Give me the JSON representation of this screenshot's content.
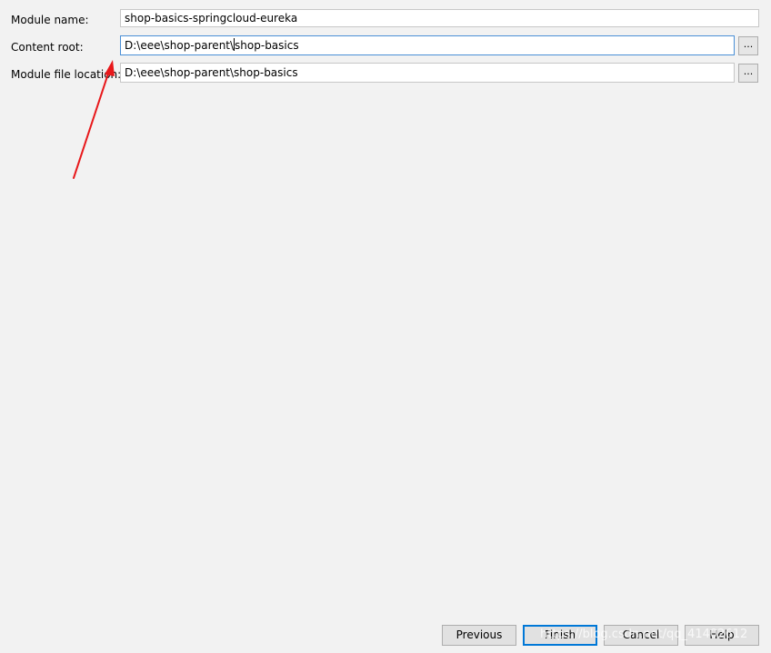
{
  "form": {
    "module_name": {
      "label": "Module name:",
      "value": "shop-basics-springcloud-eureka"
    },
    "content_root": {
      "label": "Content root:",
      "value_before_caret": "D:\\eee\\shop-parent\\",
      "value_after_caret": "shop-basics",
      "browse_label": "..."
    },
    "module_file_location": {
      "label": "Module file location:",
      "value": "D:\\eee\\shop-parent\\shop-basics",
      "browse_label": "..."
    }
  },
  "buttons": {
    "previous": "Previous",
    "finish": "Finish",
    "cancel": "Cancel",
    "help": "Help"
  },
  "annotation": {
    "arrow_color": "#e8181b",
    "focus_color": "#0078d7"
  },
  "watermark": "https://blog.csdn.net/qq_41402612"
}
